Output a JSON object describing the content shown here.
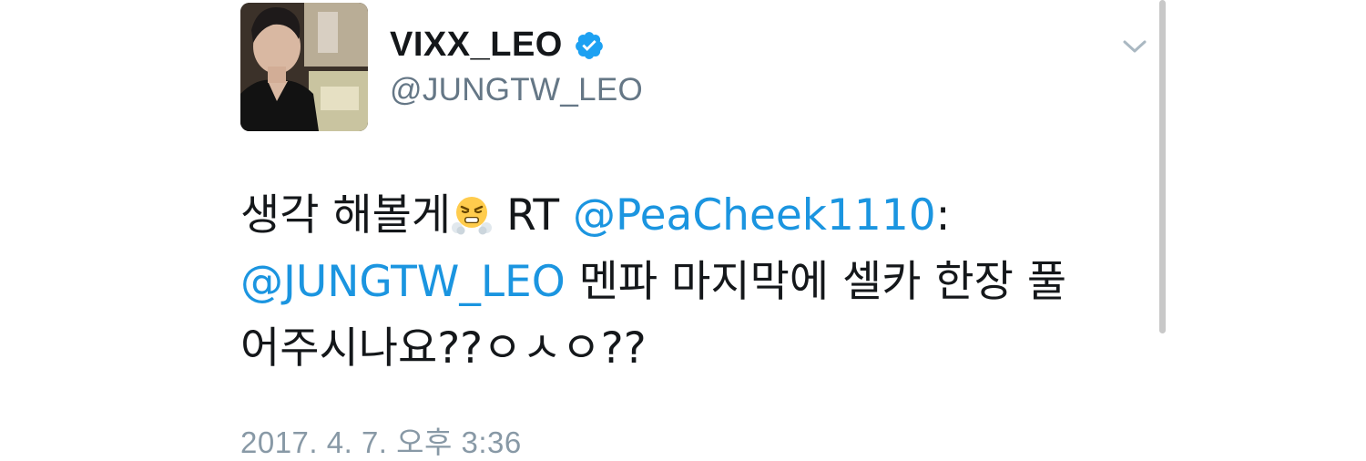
{
  "tweet": {
    "display_name": "VIXX_LEO",
    "handle": "@JUNGTW_LEO",
    "text": {
      "line1_a": "생각 해볼게",
      "line1_b": " RT ",
      "line1_mention": "@PeaCheek1110",
      "line1_c": ":",
      "line2_mention": "@JUNGTW_LEO",
      "line2_text": " 멘파 마지막에 셀카 한장 풀",
      "line3_text": "어주시나요??ㅇㅅㅇ??"
    },
    "timestamp": "2017. 4. 7. 오후 3:36"
  },
  "colors": {
    "link": "#1b95e0",
    "verified": "#1da1f2",
    "muted": "#657786"
  },
  "icons": {
    "verified": "verified-badge-icon",
    "caret": "chevron-down-icon",
    "emoji": "face-with-steam-from-nose-emoji"
  }
}
